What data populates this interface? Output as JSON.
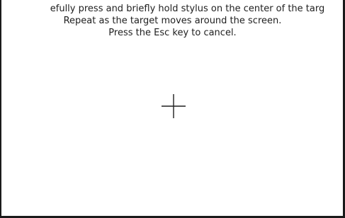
{
  "calibration": {
    "instruction_line_1": "efully press and briefly hold stylus on the center of the targ",
    "instruction_line_2": "Repeat as the target moves around the screen.",
    "instruction_line_3": "Press the Esc key to cancel.",
    "target_icon": "crosshair-icon"
  },
  "colors": {
    "background": "#ffffff",
    "text": "#1e1e1e",
    "border": "#1a1a1a"
  }
}
